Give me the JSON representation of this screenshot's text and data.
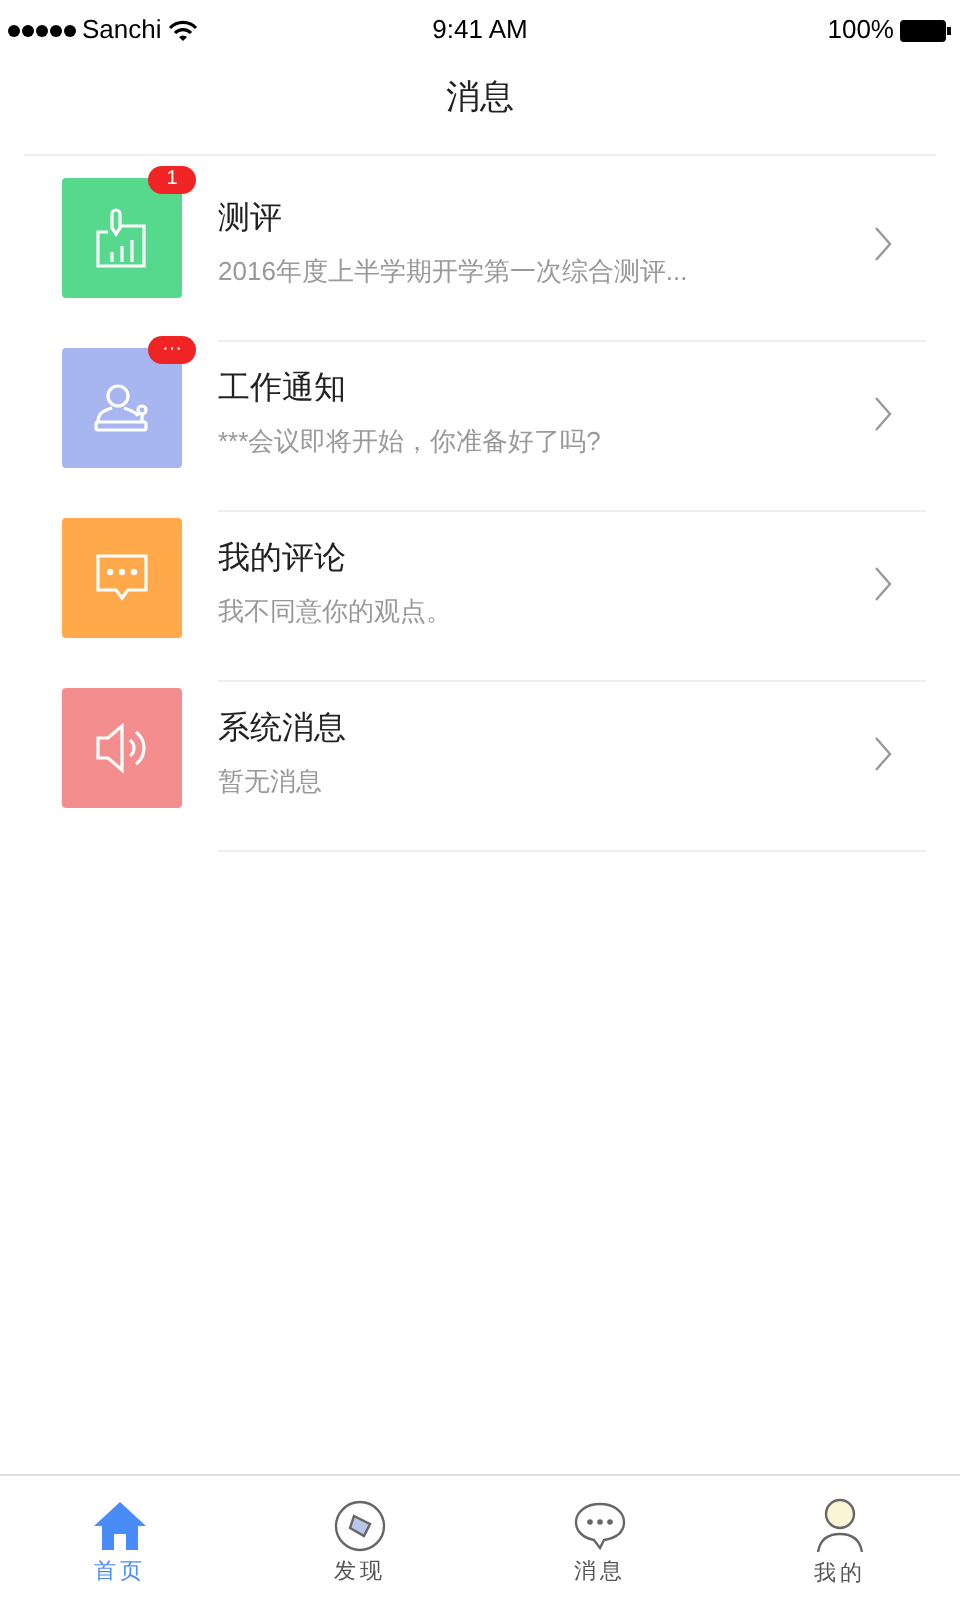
{
  "status_bar": {
    "carrier": "Sanchi",
    "time": "9:41 AM",
    "battery": "100%"
  },
  "header": {
    "title": "消息"
  },
  "messages": [
    {
      "kind": "chart",
      "color": "#57d98d",
      "badge": "1",
      "title": "测评",
      "preview": "2016年度上半学期开学第一次综合测评..."
    },
    {
      "kind": "stamp",
      "color": "#a7b6f0",
      "badge": "···",
      "title": "工作通知",
      "preview": "***会议即将开始，你准备好了吗?"
    },
    {
      "kind": "comment",
      "color": "#ffa94a",
      "title": "我的评论",
      "preview": "我不同意你的观点。"
    },
    {
      "kind": "speaker",
      "color": "#f48d8d",
      "title": "系统消息",
      "preview": "暂无消息"
    }
  ],
  "tab_bar": [
    {
      "kind": "home",
      "label": "首页",
      "selected": true
    },
    {
      "kind": "compass",
      "label": "发现",
      "selected": false
    },
    {
      "kind": "chat",
      "label": "消息",
      "selected": false
    },
    {
      "kind": "person",
      "label": "我的",
      "selected": false
    }
  ]
}
